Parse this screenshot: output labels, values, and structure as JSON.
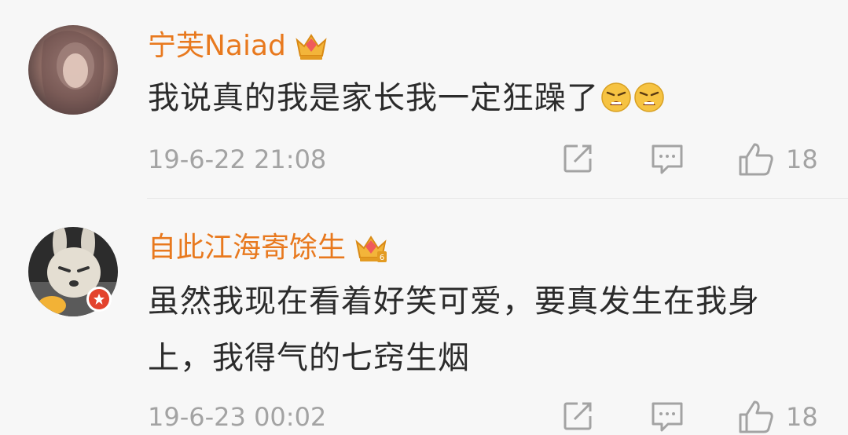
{
  "comments": [
    {
      "username": "宁芙Naiad",
      "text": "我说真的我是家长我一定狂躁了",
      "time": "19-6-22 21:08",
      "likes": "18",
      "icons": [
        "avatar",
        "crown-icon",
        "angry-emoji-icon",
        "share-icon",
        "reply-icon",
        "like-icon"
      ]
    },
    {
      "username": "自此江海寄馀生",
      "text": "虽然我现在看着好笑可爱，要真发生在我身上，我得气的七窍生烟",
      "time": "19-6-23 00:02",
      "likes": "18",
      "icons": [
        "avatar",
        "verified-badge-icon",
        "crown-6-icon",
        "share-icon",
        "reply-icon",
        "like-icon"
      ]
    }
  ],
  "colors": {
    "username": "#e8791e",
    "text": "#2b2b2b",
    "meta": "#a3a3a3",
    "background": "#f7f7f7"
  }
}
